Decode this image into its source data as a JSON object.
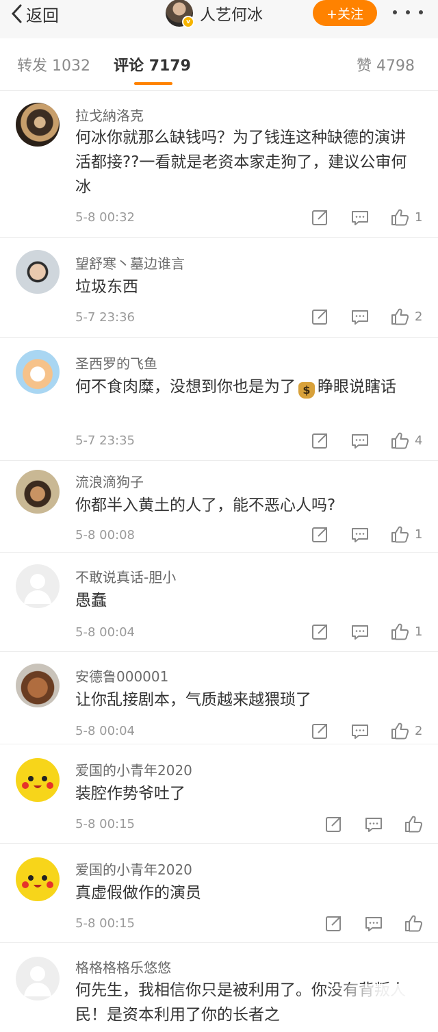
{
  "header": {
    "back_label": "返回",
    "title": "人艺何冰",
    "follow_label": "+关注",
    "more_icon": "more-dots-icon"
  },
  "tabs": [
    {
      "label": "转发",
      "count": "1032",
      "active": false
    },
    {
      "label": "评论",
      "count": "7179",
      "active": true
    },
    {
      "label": "赞",
      "count": "4798",
      "active": false
    }
  ],
  "colors": {
    "accent": "#ff8200",
    "text": "#333333",
    "muted": "#9a9a9a"
  },
  "comments": [
    {
      "user": "拉戈納洛克",
      "text": "何冰你就那么缺钱吗？为了钱连这种缺德的演讲活都接??一看就是老资本家走狗了，建议公审何冰",
      "time": "5-8 00:32",
      "likes": "1"
    },
    {
      "user": "望舒寒丶墓边谁言",
      "text": "垃圾东西",
      "time": "5-7 23:36",
      "likes": "2"
    },
    {
      "user": "圣西罗的飞鱼",
      "text_before": "何不食肉糜，没想到你也是为了",
      "emoji": "money-bag-emoji",
      "text_after": "睁眼说瞎话",
      "time": "5-7 23:35",
      "likes": "4"
    },
    {
      "user": "流浪滴狗子",
      "text": "你都半入黄土的人了，能不恶心人吗?",
      "time": "5-8 00:08",
      "likes": "1"
    },
    {
      "user": "不敢说真话-胆小",
      "text": "愚蠢",
      "time": "5-8 00:04",
      "likes": "1"
    },
    {
      "user": "安德鲁000001",
      "text": "让你乱接剧本，气质越来越猥琐了",
      "time": "5-8 00:04",
      "likes": "2"
    },
    {
      "user": "爱国的小青年2020",
      "text": "装腔作势爷吐了",
      "time": "5-8 00:15",
      "likes": ""
    },
    {
      "user": "爱国的小青年2020",
      "text": "真虚假做作的演员",
      "time": "5-8 00:15",
      "likes": ""
    },
    {
      "user": "格格格格乐悠悠",
      "text": "何先生，我相信你只是被利用了。你没有背叛人民！是资本利用了你的长者之",
      "time": "",
      "likes": ""
    }
  ],
  "icons": {
    "share": "share-icon",
    "comment": "comment-icon",
    "like": "thumb-up-icon"
  }
}
